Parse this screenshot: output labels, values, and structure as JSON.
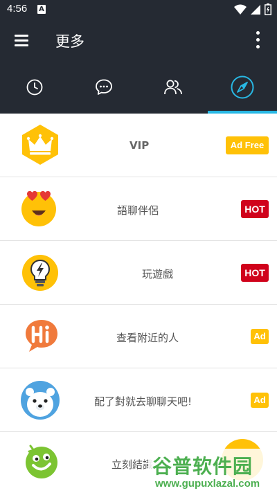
{
  "status_bar": {
    "time": "4:56",
    "notification_icon": "A"
  },
  "toolbar": {
    "title": "更多",
    "menu_icon": "hamburger-icon",
    "overflow_icon": "more-vert-icon"
  },
  "tabs": [
    {
      "icon": "clock-icon"
    },
    {
      "icon": "chat-bubble-icon"
    },
    {
      "icon": "people-icon"
    },
    {
      "icon": "compass-icon",
      "active": true
    }
  ],
  "colors": {
    "bar_bg": "#252a33",
    "accent": "#28b8e4",
    "hot": "#d0021b",
    "ad": "#ffc107"
  },
  "items": [
    {
      "label": "VIP",
      "badge": "Ad Free",
      "icon": "crown-icon"
    },
    {
      "label": "語聊伴侶",
      "badge": "HOT",
      "icon": "heart-eyes-emoji-icon"
    },
    {
      "label": "玩遊戲",
      "badge": "HOT",
      "icon": "lightbulb-icon"
    },
    {
      "label": "查看附近的人",
      "badge": "Ad",
      "icon": "hi-bubble-icon"
    },
    {
      "label": "配了對就去聊聊天吧!",
      "badge": "Ad",
      "icon": "polar-bear-icon"
    },
    {
      "label": "立刻結識",
      "badge": "",
      "icon": "green-smiley-icon"
    }
  ],
  "watermark": {
    "main": "谷普软件园",
    "url": "www.gupuxlazal.com"
  }
}
